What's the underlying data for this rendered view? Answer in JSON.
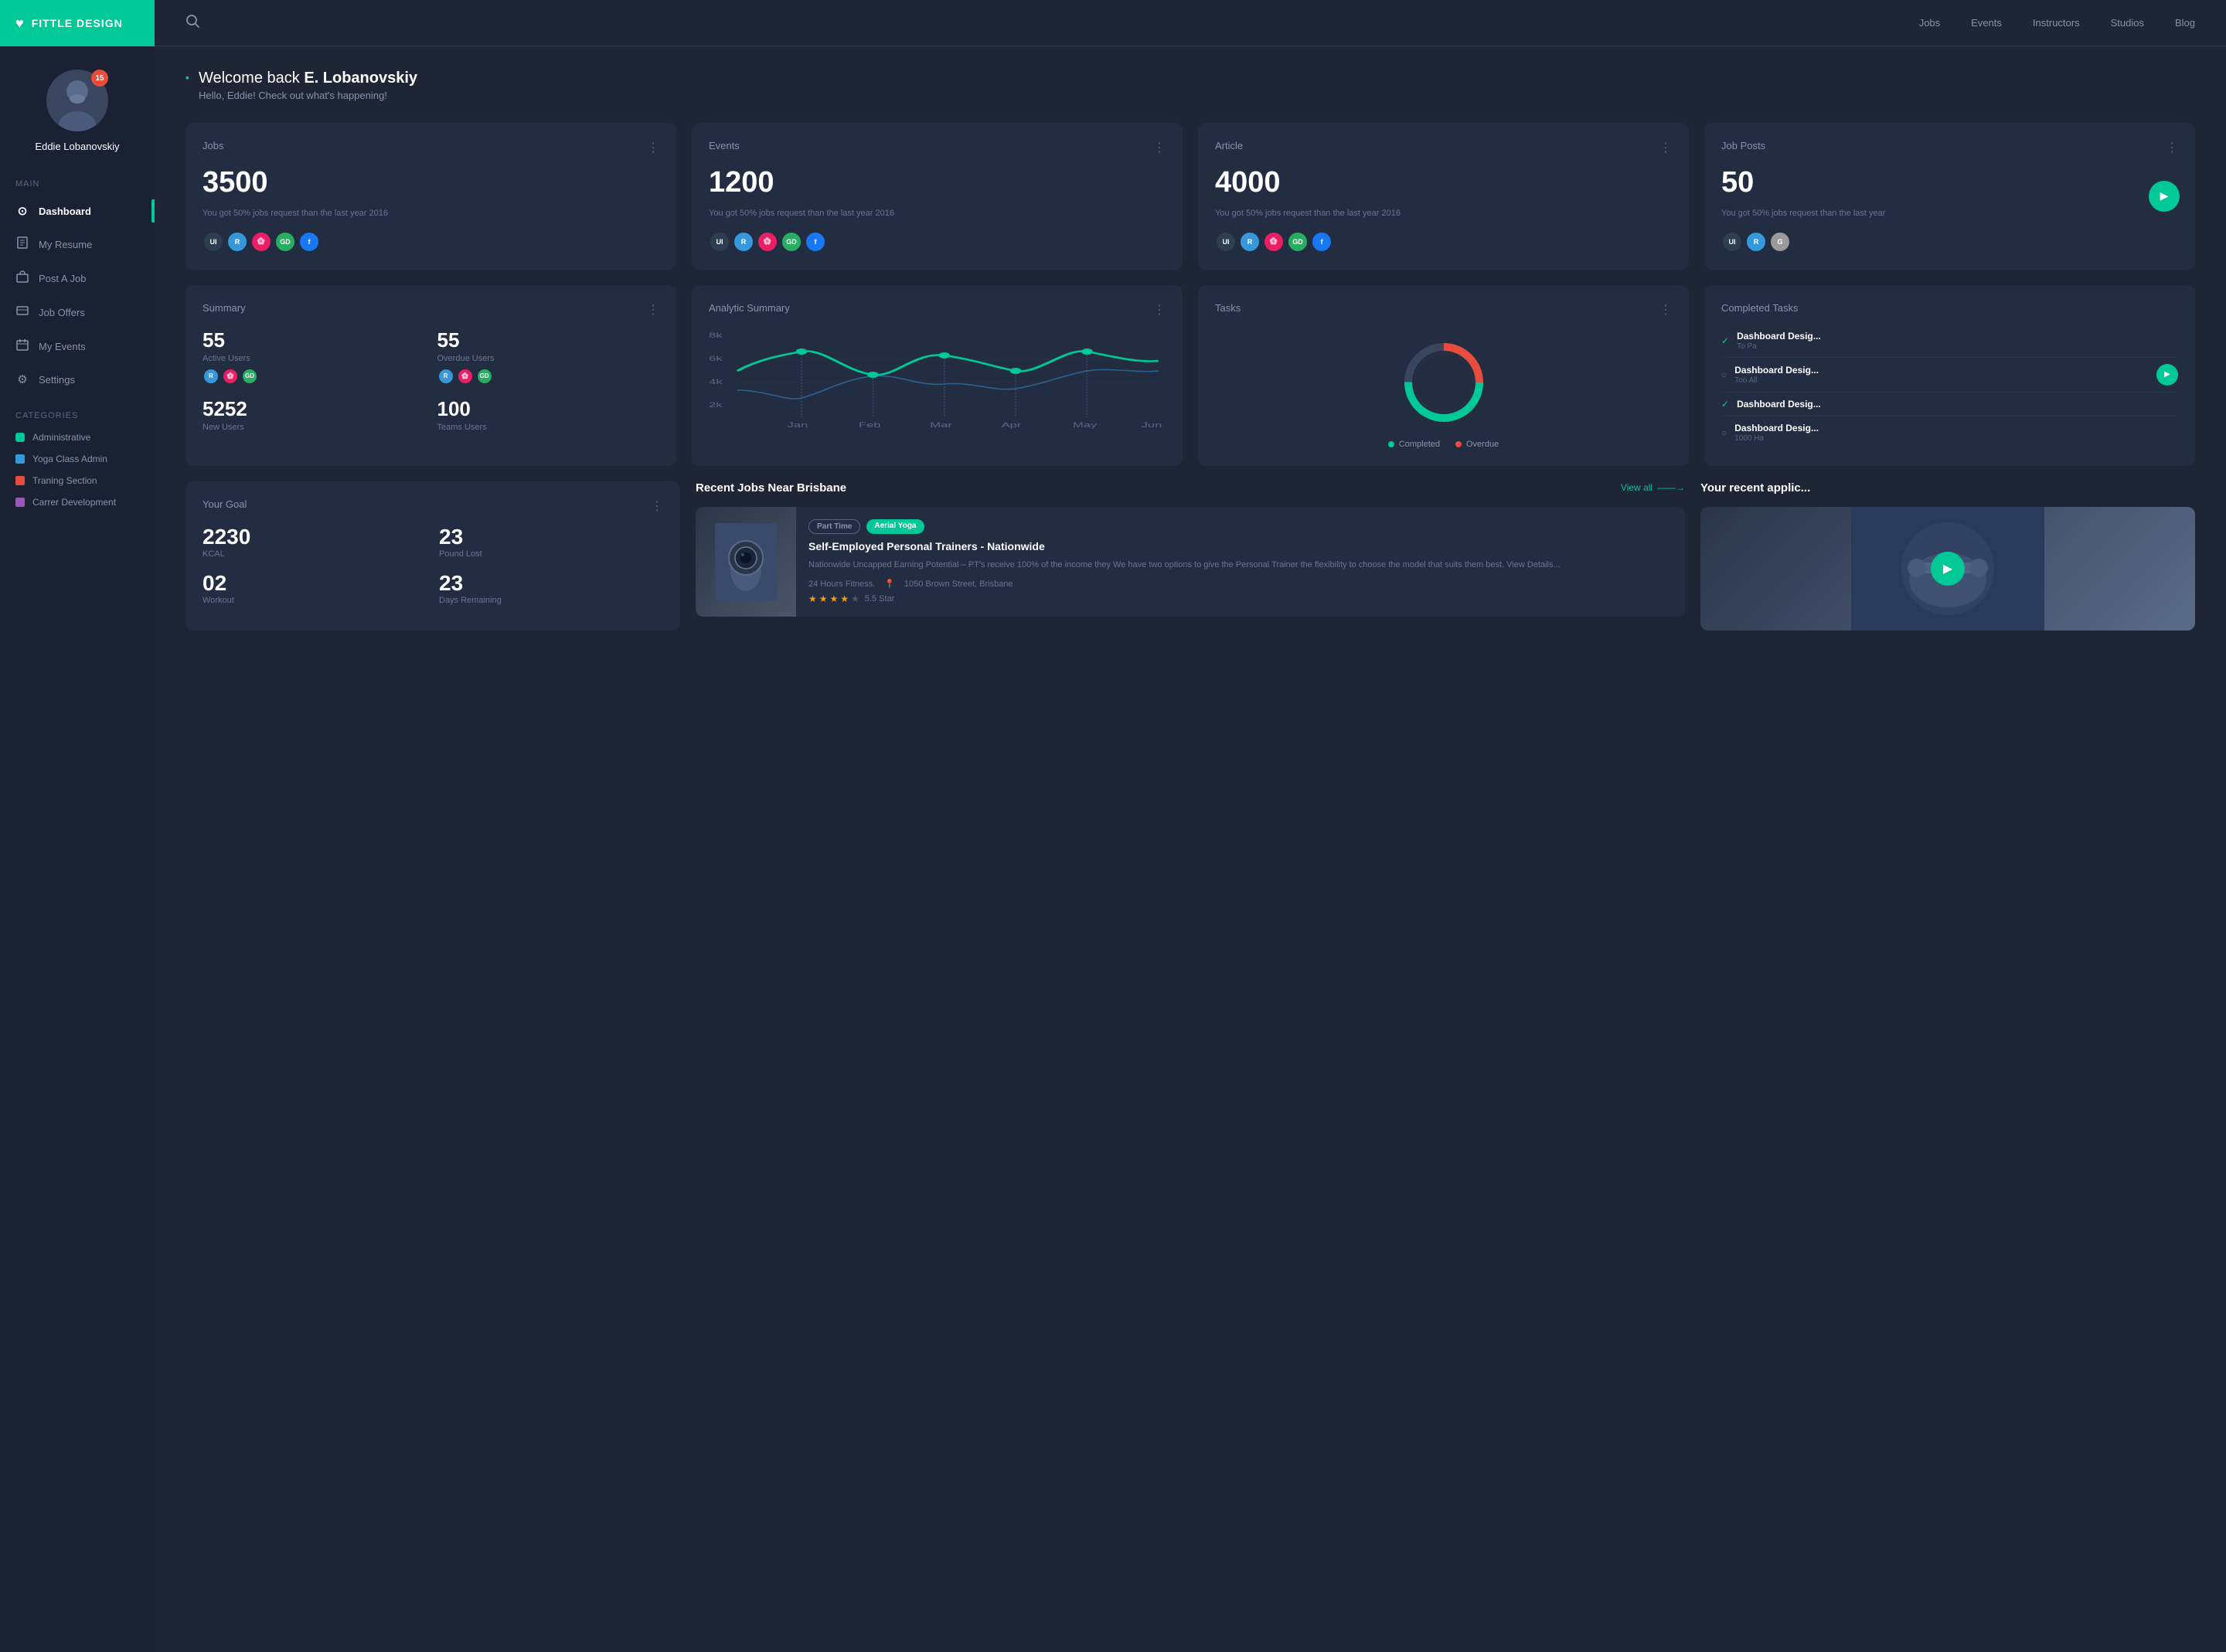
{
  "sidebar": {
    "logo": "FITTLE DESIGN",
    "heartIcon": "♥",
    "profile": {
      "name": "Eddie Lobanovskiy",
      "badge": "15"
    },
    "main_label": "Main",
    "nav": [
      {
        "id": "dashboard",
        "icon": "⊙",
        "label": "Dashboard",
        "active": true
      },
      {
        "id": "resume",
        "icon": "📄",
        "label": "My Resume",
        "active": false
      },
      {
        "id": "postjob",
        "icon": "💼",
        "label": "Post A Job",
        "active": false
      },
      {
        "id": "joboffers",
        "icon": "🗂",
        "label": "Job Offers",
        "active": false
      },
      {
        "id": "events",
        "icon": "📅",
        "label": "My Events",
        "active": false
      },
      {
        "id": "settings",
        "icon": "⚙",
        "label": "Settings",
        "active": false
      }
    ],
    "categories_label": "Categories",
    "categories": [
      {
        "label": "Administrative",
        "color": "#00c896"
      },
      {
        "label": "Yoga Class Admin",
        "color": "#3498db"
      },
      {
        "label": "Traning Section",
        "color": "#e74c3c"
      },
      {
        "label": "Carrer Development",
        "color": "#9b59b6"
      }
    ]
  },
  "topnav": {
    "links": [
      "Jobs",
      "Events",
      "Instructors",
      "Studios",
      "Blog"
    ]
  },
  "welcome": {
    "title_prefix": "Welcome back ",
    "name": "E. Lobanovskiy",
    "subtitle": "Hello, Eddie! Check out what's happening!"
  },
  "cards": [
    {
      "id": "jobs",
      "title": "Jobs",
      "value": "3500",
      "desc": "You got 50% jobs request than the last year 2016",
      "avatars": [
        "UI",
        "R",
        "GD",
        "F"
      ],
      "avatar_colors": [
        "#2c3e50",
        "#3498db",
        "#e91e63",
        "#1877f2"
      ]
    },
    {
      "id": "events",
      "title": "Events",
      "value": "1200",
      "desc": "You got 50% jobs request than the last year 2016",
      "avatars": [
        "UI",
        "R",
        "GD",
        "F"
      ],
      "avatar_colors": [
        "#2c3e50",
        "#3498db",
        "#e91e63",
        "#1877f2"
      ]
    },
    {
      "id": "article",
      "title": "Article",
      "value": "4000",
      "desc": "You got 50% jobs request than the last year 2016",
      "avatars": [
        "UI",
        "R",
        "GD",
        "F"
      ],
      "avatar_colors": [
        "#2c3e50",
        "#3498db",
        "#e91e63",
        "#1877f2"
      ]
    },
    {
      "id": "jobposts",
      "title": "Job Posts",
      "value": "50",
      "desc": "You got 50% jobs request than the last year",
      "avatars": [
        "UI",
        "R",
        "G"
      ],
      "avatar_colors": [
        "#2c3e50",
        "#3498db",
        "#9b9b9b"
      ],
      "has_play": true
    }
  ],
  "summary": {
    "title": "Summary",
    "items": [
      {
        "value": "55",
        "label": "Active Users",
        "avatars": [
          "R",
          "P",
          "GD"
        ],
        "colors": [
          "#3498db",
          "#e91e63",
          "#27ae60"
        ]
      },
      {
        "value": "55",
        "label": "Overdue Users",
        "avatars": [
          "R",
          "P",
          "GD"
        ],
        "colors": [
          "#3498db",
          "#e91e63",
          "#27ae60"
        ]
      },
      {
        "value": "5252",
        "label": "New Users"
      },
      {
        "value": "100",
        "label": "Teams Users"
      }
    ]
  },
  "analytic": {
    "title": "Analytic Summary",
    "months": [
      "Jan",
      "Feb",
      "Mar",
      "Apr",
      "May",
      "Jun"
    ],
    "yLabels": [
      "8k",
      "6k",
      "4k",
      "2k"
    ]
  },
  "tasks": {
    "title": "Tasks",
    "completed_pct": 75,
    "overdue_pct": 25,
    "legend": [
      {
        "label": "Completed",
        "color": "#00c896"
      },
      {
        "label": "Overdue",
        "color": "#e74c3c"
      }
    ]
  },
  "completed_tasks": {
    "title": "Completed Tasks",
    "items": [
      {
        "text": "Dashboard Desig...",
        "sub": "To Pa",
        "done": true,
        "has_play": false
      },
      {
        "text": "Dashboard Desig...",
        "sub": "Too All",
        "done": false,
        "has_play": true
      },
      {
        "text": "Dashboard Desig...",
        "sub": "",
        "done": true,
        "has_play": false
      },
      {
        "text": "Dashboard Desig...",
        "sub": "1000 Ha",
        "done": false,
        "has_play": false
      }
    ]
  },
  "goal": {
    "title": "Your Goal",
    "items": [
      {
        "value": "2230",
        "label": "KCAL"
      },
      {
        "value": "23",
        "label": "Pound Lost"
      },
      {
        "value": "02",
        "label": "Workout"
      },
      {
        "value": "23",
        "label": "Days Remaining"
      }
    ]
  },
  "recent_jobs": {
    "title": "Recent Jobs Near Brisbane",
    "view_all": "View all",
    "job": {
      "tags": [
        "Part Time",
        "Aerial Yoga"
      ],
      "title": "Self-Employed Personal Trainers - Nationwide",
      "desc": "Nationwide Uncapped Earning Potential – PT's receive 100% of the income they We have two options to give the Personal Trainer the flexibility to choose the model that suits them best. View Details...",
      "company": "24 Hours Fitness.",
      "location": "1050 Brown Street, Brisbane",
      "rating": 3.5,
      "rating_label": "5.5 Star"
    }
  },
  "recent_apps": {
    "title": "Your recent applic..."
  }
}
